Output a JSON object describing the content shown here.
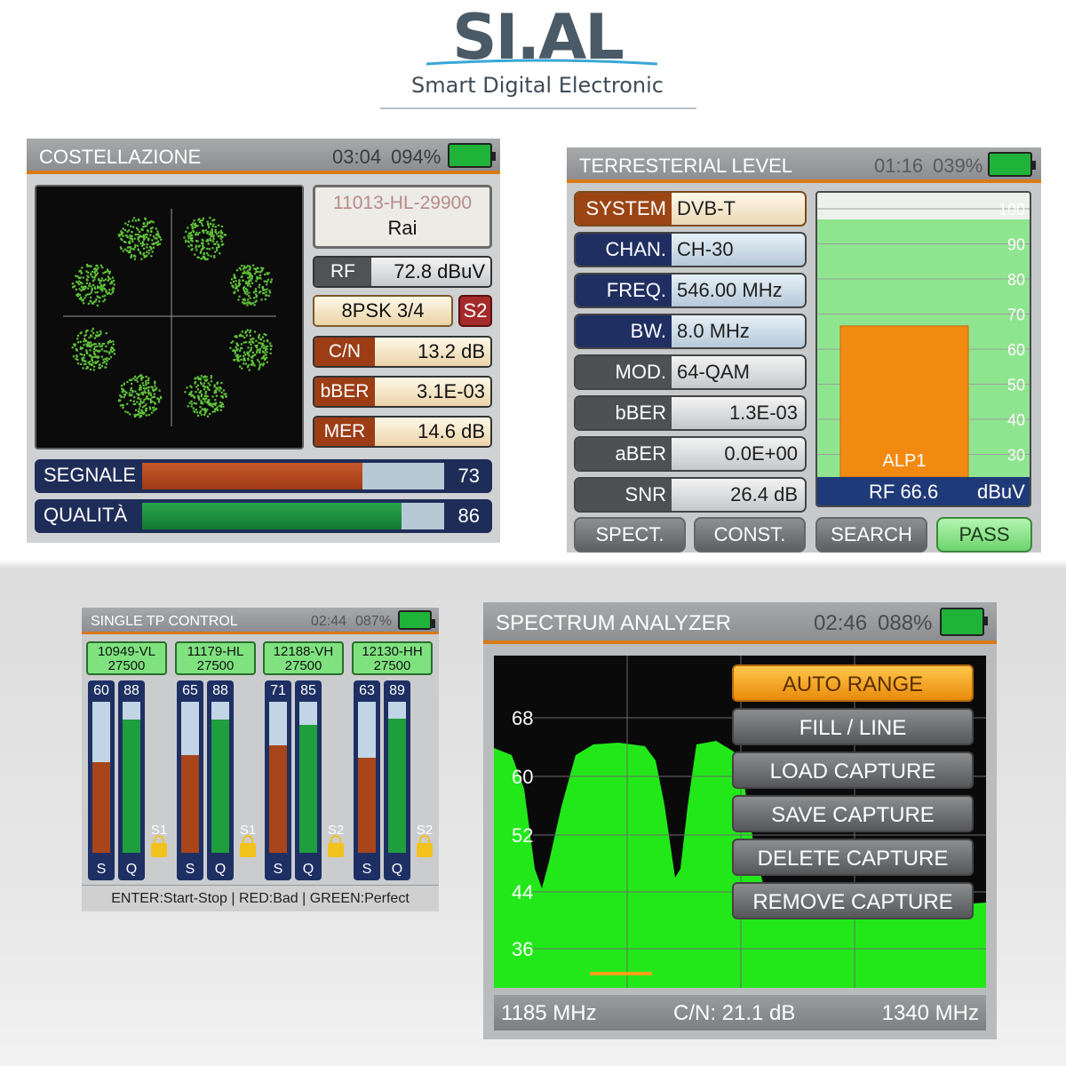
{
  "logo": {
    "brand": "SI.AL",
    "tagline": "Smart Digital Electronic"
  },
  "constellation": {
    "title": "COSTELLAZIONE",
    "time": "03:04",
    "battery": "094%",
    "transponder": "11013-HL-29900",
    "provider": "Rai",
    "rf_label": "RF",
    "rf_value": "72.8 dBuV",
    "modulation": "8PSK 3/4",
    "standard": "S2",
    "cn_label": "C/N",
    "cn_value": "13.2 dB",
    "ber_label": "bBER",
    "ber_value": "3.1E-03",
    "mer_label": "MER",
    "mer_value": "14.6 dB",
    "signal_label": "SEGNALE",
    "signal_value": "73",
    "signal_fraction": 0.73,
    "quality_label": "QUALITÀ",
    "quality_value": "86",
    "quality_fraction": 0.86
  },
  "terrestrial": {
    "title": "TERRESTERIAL LEVEL",
    "time": "01:16",
    "battery": "039%",
    "rows": [
      {
        "label": "SYSTEM",
        "value": "DVB-T"
      },
      {
        "label": "CHAN.",
        "value": "CH-30"
      },
      {
        "label": "FREQ.",
        "value": "546.00 MHz"
      },
      {
        "label": "BW.",
        "value": "8.0 MHz"
      },
      {
        "label": "MOD.",
        "value": "64-QAM"
      },
      {
        "label": "bBER",
        "value": "1.3E-03"
      },
      {
        "label": "aBER",
        "value": "0.0E+00"
      },
      {
        "label": "SNR",
        "value": "26.4 dB"
      }
    ],
    "scale": [
      "100",
      "90",
      "80",
      "70",
      "60",
      "50",
      "40",
      "30"
    ],
    "bar_label": "ALP1",
    "rf_text": "RF 66.6",
    "rf_unit": "dBuV",
    "rf_level": 66.6,
    "buttons": {
      "spect": "SPECT.",
      "const": "CONST.",
      "search": "SEARCH",
      "pass": "PASS"
    }
  },
  "single_tp": {
    "title": "SINGLE TP CONTROL",
    "time": "02:44",
    "battery": "087%",
    "transponders": [
      {
        "freq": "10949-VL",
        "sr": "27500",
        "s": "60",
        "q": "88",
        "sys": "S1"
      },
      {
        "freq": "11179-HL",
        "sr": "27500",
        "s": "65",
        "q": "88",
        "sys": "S1"
      },
      {
        "freq": "12188-VH",
        "sr": "27500",
        "s": "71",
        "q": "85",
        "sys": "S2"
      },
      {
        "freq": "12130-HH",
        "sr": "27500",
        "s": "63",
        "q": "89",
        "sys": "S2"
      }
    ],
    "s_label": "S",
    "q_label": "Q",
    "footer": "ENTER:Start-Stop | RED:Bad | GREEN:Perfect"
  },
  "spectrum": {
    "title": "SPECTRUM ANALYZER",
    "time": "02:46",
    "battery": "088%",
    "y_ticks": [
      "68",
      "60",
      "52",
      "44",
      "36"
    ],
    "menu": [
      "AUTO RANGE",
      "FILL / LINE",
      "LOAD CAPTURE",
      "SAVE CAPTURE",
      "DELETE CAPTURE",
      "REMOVE CAPTURE"
    ],
    "freq_start": "1185 MHz",
    "cn": "C/N: 21.1 dB",
    "freq_end": "1340 MHz",
    "colors": {
      "trace": "#22e81a",
      "accent": "#f3a21a"
    }
  }
}
